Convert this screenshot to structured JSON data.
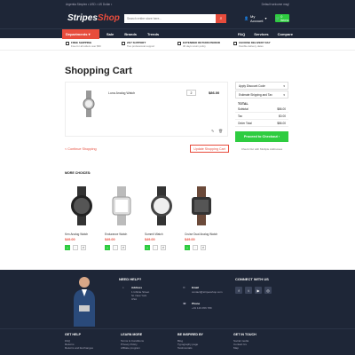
{
  "topbar": {
    "left": "Argentia Simplex • USD • US Dollar •",
    "right": "Default welcome msg!"
  },
  "header": {
    "logo_main": "Stripes",
    "logo_sub": "Shop",
    "search_placeholder": "Search entire store here...",
    "account": "My Account",
    "cart": "0 items"
  },
  "nav": {
    "departments": "Departments",
    "items": [
      "Sale",
      "Brands",
      "Trends"
    ],
    "right": [
      "FAQ",
      "Services",
      "Compare"
    ]
  },
  "features": [
    {
      "title": "FREE SHIPPING",
      "sub": "Free for all orders over $50"
    },
    {
      "title": "24/7 SUPPORT",
      "sub": "Two professional support"
    },
    {
      "title": "EXTENDED RETURN PERIOD",
      "sub": "30 days return policy"
    },
    {
      "title": "CHOOSE DELIVERY DAY",
      "sub": "Flexible delivery dates"
    }
  ],
  "page_title": "Shopping Cart",
  "cart": {
    "product_name": "Luna Analog Watch",
    "qty": "2",
    "price": "$86.00"
  },
  "continue": "< Continue Shopping",
  "update": "Update Shopping Cart",
  "summary": {
    "discount": "Apply Discount Code",
    "estimate": "Estimate Shipping and Tax",
    "total_title": "TOTAL",
    "rows": [
      {
        "label": "Subtotal",
        "value": "$86.00"
      },
      {
        "label": "Tax",
        "value": "$0.00"
      },
      {
        "label": "Order Total",
        "value": "$86.00"
      }
    ],
    "checkout": "Proceed to Checkout",
    "multi": "Check Out with Multiple Addresses"
  },
  "more_choices": "MORE CHOICES:",
  "products": [
    {
      "name": "Ken Analog Watch",
      "price": "$49.00"
    },
    {
      "name": "Endurance Watch",
      "price": "$49.00"
    },
    {
      "name": "Summit Watch",
      "price": "$49.00"
    },
    {
      "name": "Cruise Dual Analog Watch",
      "price": "$49.00"
    }
  ],
  "footer": {
    "need_help": "NEED HELP?",
    "address_label": "Address",
    "address": "1 Infinite Street St. New York USA",
    "email_label": "Email",
    "email": "contact@stripesshop.com",
    "phone_label": "Phone",
    "phone": "+01 123 456 789",
    "connect": "CONNECT WITH US",
    "social": [
      "f",
      "t",
      "▶",
      "◎"
    ],
    "cols": [
      {
        "title": "GET HELP",
        "links": [
          "FAQ",
          "Returns",
          "Returns and Exchanges"
        ]
      },
      {
        "title": "LEARN MORE",
        "links": [
          "Terms & Conditions",
          "Privacy Policy",
          "Affiliate program"
        ]
      },
      {
        "title": "BE INSPIRED BY",
        "links": [
          "Blog",
          "Typography page",
          "Testimonials"
        ]
      },
      {
        "title": "GET IN TOUCH",
        "links": [
          "Social media",
          "Contact Us",
          "Map"
        ]
      }
    ]
  }
}
